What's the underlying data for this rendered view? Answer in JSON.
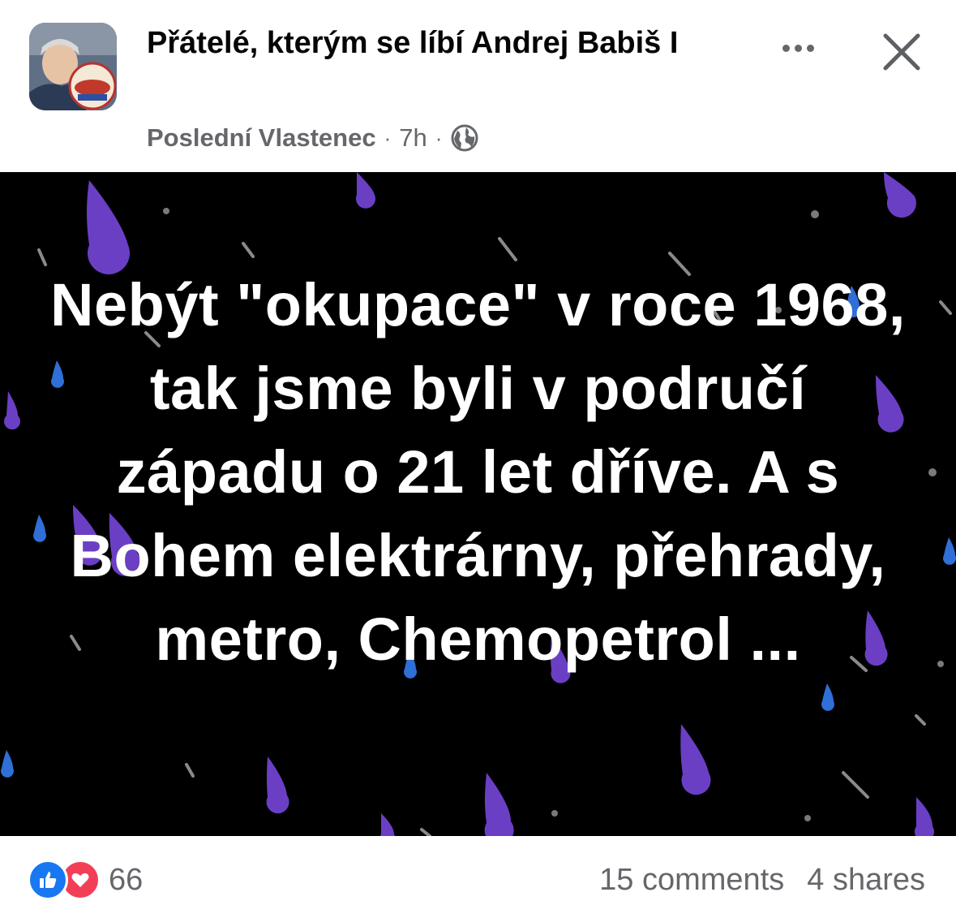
{
  "post": {
    "group_title": "Přátelé, kterým se líbí Andrej Babiš I",
    "author": "Poslední Vlastenec",
    "time": "7h",
    "separator": "·",
    "privacy_icon": "globe-icon",
    "more_icon": "more-horizontal-icon",
    "close_icon": "close-icon"
  },
  "image": {
    "text": "Nebýt \"okupace\" v roce 1968, tak jsme byli v područí západu o 21 let dříve. A s Bohem elektrárny, přehrady, metro, Chemopetrol ...",
    "background_color": "#000000",
    "drop_colors": [
      "#6a3fc4",
      "#2f6fd6"
    ]
  },
  "footer": {
    "reaction_icons": [
      "like-icon",
      "love-icon"
    ],
    "reaction_count": "66",
    "comments": "15 comments",
    "shares": "4 shares"
  },
  "colors": {
    "secondary_text": "#65676b",
    "like_blue": "#1877f2",
    "love_red": "#f33e58"
  }
}
